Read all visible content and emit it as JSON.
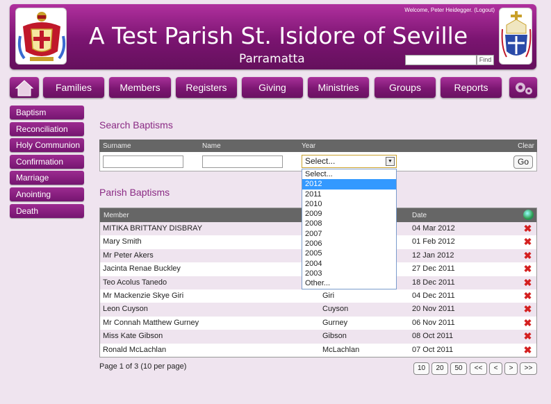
{
  "header": {
    "title": "A Test Parish St. Isidore of Seville",
    "subtitle": "Parramatta",
    "welcome": "Welcome, Peter Heidegger.",
    "logout": "(Logout)",
    "find_label": "Find"
  },
  "nav": {
    "items": [
      "Families",
      "Members",
      "Registers",
      "Giving",
      "Ministries",
      "Groups",
      "Reports"
    ]
  },
  "sidebar": {
    "items": [
      "Baptism",
      "Reconciliation",
      "Holy Communion",
      "Confirmation",
      "Marriage",
      "Anointing",
      "Death"
    ]
  },
  "search": {
    "title": "Search Baptisms",
    "col_surname": "Surname",
    "col_name": "Name",
    "col_year": "Year",
    "col_clear": "Clear",
    "year_selected": "Select...",
    "go_label": "Go",
    "year_options": [
      "Select...",
      "2012",
      "2011",
      "2010",
      "2009",
      "2008",
      "2007",
      "2006",
      "2005",
      "2004",
      "2003",
      "Other..."
    ],
    "highlighted_option": "2012"
  },
  "results": {
    "title": "Parish Baptisms",
    "col_member": "Member",
    "col_date": "Date",
    "rows": [
      {
        "member": "MITIKA BRITTANY DISBRAY",
        "surname": "",
        "date": "04 Mar 2012"
      },
      {
        "member": "Mary Smith",
        "surname": "",
        "date": "01 Feb 2012"
      },
      {
        "member": "Mr Peter Akers",
        "surname": "",
        "date": "12 Jan 2012"
      },
      {
        "member": "Jacinta Renae Buckley",
        "surname": "",
        "date": "27 Dec 2011"
      },
      {
        "member": "Teo Acolus Tanedo",
        "surname": "",
        "date": "18 Dec 2011"
      },
      {
        "member": "Mr Mackenzie Skye Giri",
        "surname": "Giri",
        "date": "04 Dec 2011"
      },
      {
        "member": "Leon Cuyson",
        "surname": "Cuyson",
        "date": "20 Nov 2011"
      },
      {
        "member": "Mr Connah Matthew Gurney",
        "surname": "Gurney",
        "date": "06 Nov 2011"
      },
      {
        "member": "Miss Kate Gibson",
        "surname": "Gibson",
        "date": "08 Oct 2011"
      },
      {
        "member": "Ronald McLachlan",
        "surname": "McLachlan",
        "date": "07 Oct 2011"
      }
    ]
  },
  "pager": {
    "summary": "Page 1 of 3 (10 per page)",
    "buttons": [
      "10",
      "20",
      "50",
      "<<",
      "<",
      ">",
      ">>"
    ]
  },
  "colors": {
    "brand": "#7a1470",
    "accent_text": "#8a2a84",
    "background": "#efe4ef",
    "delete": "#d42020"
  }
}
